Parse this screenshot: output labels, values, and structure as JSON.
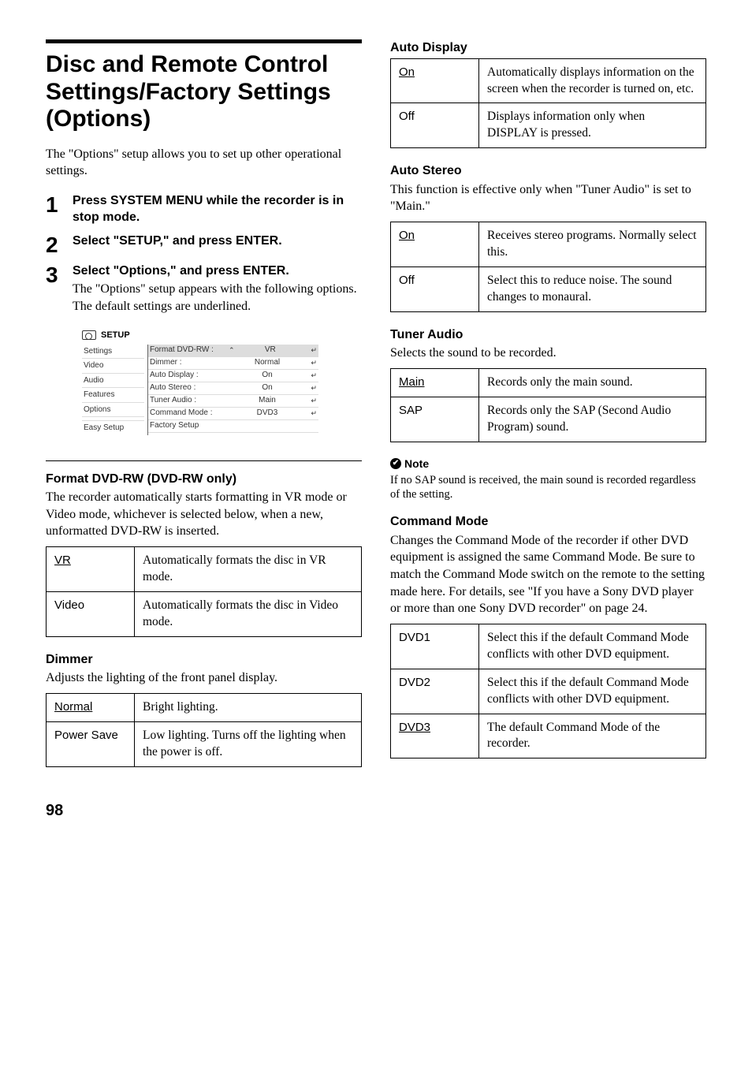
{
  "page_number": "98",
  "title": "Disc and Remote Control Settings/Factory Settings (Options)",
  "intro": "The \"Options\" setup allows you to set up other operational settings.",
  "steps": [
    {
      "num": "1",
      "head": "Press SYSTEM MENU while the recorder is in stop mode."
    },
    {
      "num": "2",
      "head": "Select \"SETUP,\" and press ENTER."
    },
    {
      "num": "3",
      "head": "Select \"Options,\" and press ENTER.",
      "desc": "The \"Options\" setup appears with the following options. The default settings are underlined."
    }
  ],
  "setup_panel": {
    "title": "SETUP",
    "left": [
      "Settings",
      "Video",
      "Audio",
      "Features",
      "Options",
      "",
      "Easy Setup"
    ],
    "right": [
      {
        "k": "Format DVD-RW :",
        "v": "VR"
      },
      {
        "k": "Dimmer :",
        "v": "Normal"
      },
      {
        "k": "Auto Display :",
        "v": "On"
      },
      {
        "k": "Auto Stereo :",
        "v": "On"
      },
      {
        "k": "Tuner Audio :",
        "v": "Main"
      },
      {
        "k": "Command Mode :",
        "v": "DVD3"
      },
      {
        "k": "Factory Setup",
        "v": ""
      }
    ]
  },
  "sections": {
    "format": {
      "head": "Format DVD-RW (DVD-RW only)",
      "text": "The recorder automatically starts formatting in VR mode or Video mode, whichever is selected below, when a new, unformatted DVD-RW is inserted.",
      "rows": [
        {
          "k": "VR",
          "d": true,
          "v": "Automatically formats the disc in VR mode."
        },
        {
          "k": "Video",
          "d": false,
          "v": "Automatically formats the disc in Video mode."
        }
      ]
    },
    "dimmer": {
      "head": "Dimmer",
      "text": "Adjusts the lighting of the front panel display.",
      "rows": [
        {
          "k": "Normal",
          "d": true,
          "v": "Bright lighting."
        },
        {
          "k": "Power Save",
          "d": false,
          "v": "Low lighting. Turns off the lighting when the power is off."
        }
      ]
    },
    "auto_display": {
      "head": "Auto Display",
      "rows": [
        {
          "k": "On",
          "d": true,
          "v": "Automatically displays information on the screen when the recorder is turned on, etc."
        },
        {
          "k": "Off",
          "d": false,
          "v": "Displays information only when DISPLAY is pressed."
        }
      ]
    },
    "auto_stereo": {
      "head": "Auto Stereo",
      "text": "This function is effective only when \"Tuner Audio\" is set to \"Main.\"",
      "rows": [
        {
          "k": "On",
          "d": true,
          "v": "Receives stereo programs. Normally select this."
        },
        {
          "k": "Off",
          "d": false,
          "v": "Select this to reduce noise. The sound changes to monaural."
        }
      ]
    },
    "tuner_audio": {
      "head": "Tuner Audio",
      "text": "Selects the sound to be recorded.",
      "rows": [
        {
          "k": "Main",
          "d": true,
          "v": "Records only the main sound."
        },
        {
          "k": "SAP",
          "d": false,
          "v": "Records only the SAP (Second Audio Program) sound."
        }
      ]
    },
    "note": {
      "head": "Note",
      "body": "If no SAP sound is received, the main sound is recorded regardless of the setting."
    },
    "command_mode": {
      "head": "Command Mode",
      "text": "Changes the Command Mode of the recorder if other DVD equipment is assigned the same Command Mode. Be sure to match the Command Mode switch on the remote to the setting made here. For details, see \"If you have a Sony DVD player or more than one Sony DVD recorder\" on page 24.",
      "rows": [
        {
          "k": "DVD1",
          "d": false,
          "v": "Select this if the default Command Mode conflicts with other DVD equipment."
        },
        {
          "k": "DVD2",
          "d": false,
          "v": "Select this if the default Command Mode conflicts with other DVD equipment."
        },
        {
          "k": "DVD3",
          "d": true,
          "v": "The default Command Mode of the recorder."
        }
      ]
    }
  }
}
